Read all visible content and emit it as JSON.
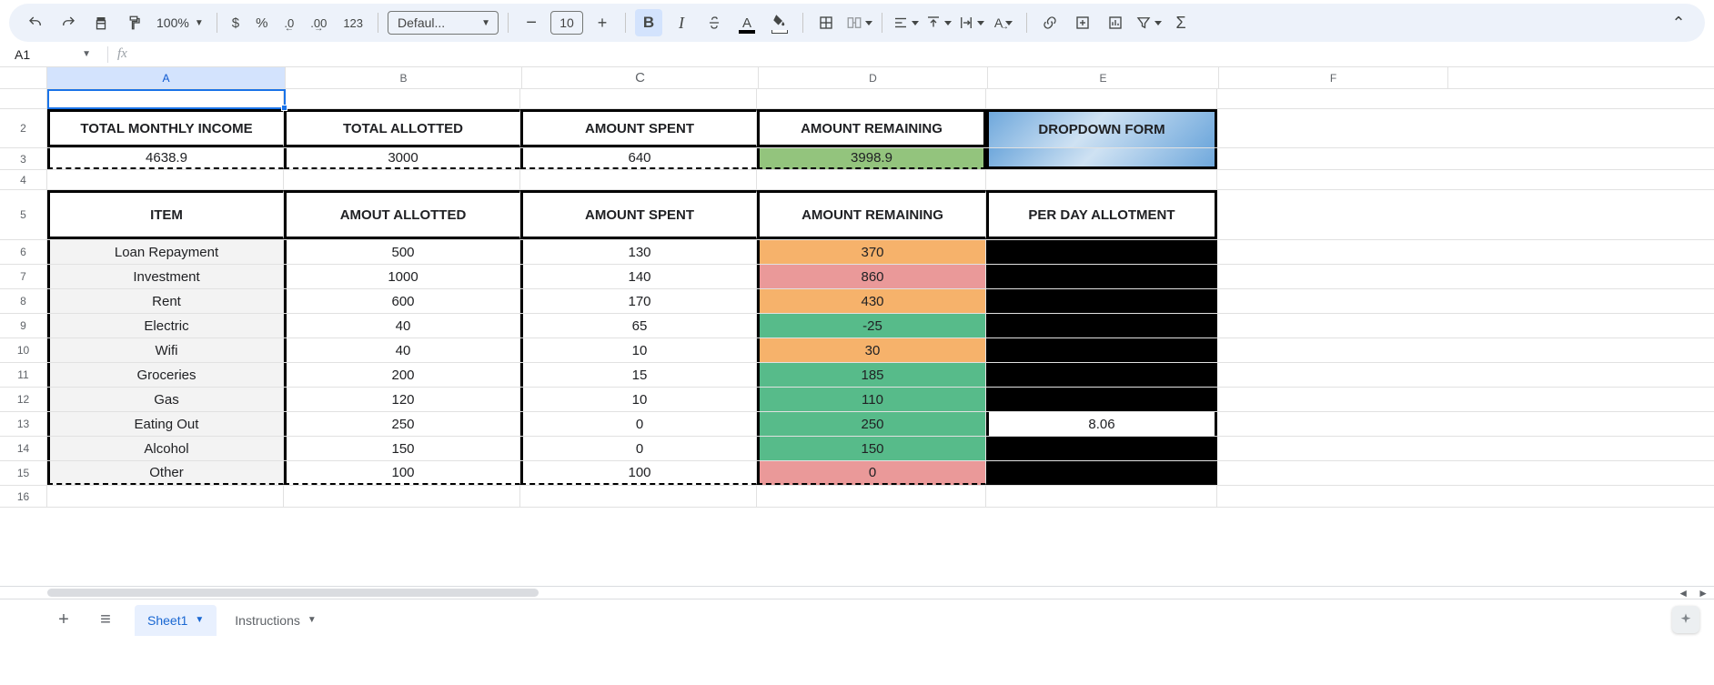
{
  "toolbar": {
    "zoom": "100%",
    "currency": "$",
    "percent": "%",
    "dec_dec": ".0",
    "dec_inc": ".00",
    "num_123": "123",
    "font_name": "Defaul...",
    "font_size": "10",
    "bold": "B",
    "italic": "I",
    "text_color": "A",
    "text_rotate": "A"
  },
  "namebox": "A1",
  "formula": "",
  "cols": {
    "a": "A",
    "b": "B",
    "c": "C",
    "d": "D",
    "e": "E",
    "f": "F"
  },
  "sheet": {
    "summary_hdr": {
      "a": "TOTAL MONTHLY INCOME",
      "b": "TOTAL ALLOTTED",
      "c": "AMOUNT SPENT",
      "d": "AMOUNT REMAINING"
    },
    "dropdown_label": "DROPDOWN FORM",
    "summary_val": {
      "a": "4638.9",
      "b": "3000",
      "c": "640",
      "d": "3998.9"
    },
    "table_hdr": {
      "a": "ITEM",
      "b": "AMOUT ALLOTTED",
      "c": "AMOUNT SPENT",
      "d": "AMOUNT REMAINING",
      "e": "PER DAY ALLOTMENT"
    },
    "rows": [
      {
        "item": "Loan Repayment",
        "allotted": "500",
        "spent": "130",
        "remaining": "370",
        "rem_cls": "bg-og",
        "perday": "",
        "pd_cls": "bg-blk"
      },
      {
        "item": "Investment",
        "allotted": "1000",
        "spent": "140",
        "remaining": "860",
        "rem_cls": "bg-pk",
        "perday": "",
        "pd_cls": "bg-blk"
      },
      {
        "item": "Rent",
        "allotted": "600",
        "spent": "170",
        "remaining": "430",
        "rem_cls": "bg-og",
        "perday": "",
        "pd_cls": "bg-blk"
      },
      {
        "item": "Electric",
        "allotted": "40",
        "spent": "65",
        "remaining": "-25",
        "rem_cls": "bg-gn2",
        "perday": "",
        "pd_cls": "bg-blk"
      },
      {
        "item": "Wifi",
        "allotted": "40",
        "spent": "10",
        "remaining": "30",
        "rem_cls": "bg-og",
        "perday": "",
        "pd_cls": "bg-blk"
      },
      {
        "item": "Groceries",
        "allotted": "200",
        "spent": "15",
        "remaining": "185",
        "rem_cls": "bg-gn2",
        "perday": "",
        "pd_cls": "bg-blk"
      },
      {
        "item": "Gas",
        "allotted": "120",
        "spent": "10",
        "remaining": "110",
        "rem_cls": "bg-gn2",
        "perday": "",
        "pd_cls": "bg-blk"
      },
      {
        "item": "Eating Out",
        "allotted": "250",
        "spent": "0",
        "remaining": "250",
        "rem_cls": "bg-gn2",
        "perday": "8.06",
        "pd_cls": ""
      },
      {
        "item": "Alcohol",
        "allotted": "150",
        "spent": "0",
        "remaining": "150",
        "rem_cls": "bg-gn2",
        "perday": "",
        "pd_cls": "bg-blk"
      },
      {
        "item": "Other",
        "allotted": "100",
        "spent": "100",
        "remaining": "0",
        "rem_cls": "bg-pk",
        "perday": "",
        "pd_cls": "bg-blk"
      }
    ]
  },
  "tabs": [
    {
      "name": "Sheet1",
      "active": true
    },
    {
      "name": "Instructions",
      "active": false
    }
  ]
}
